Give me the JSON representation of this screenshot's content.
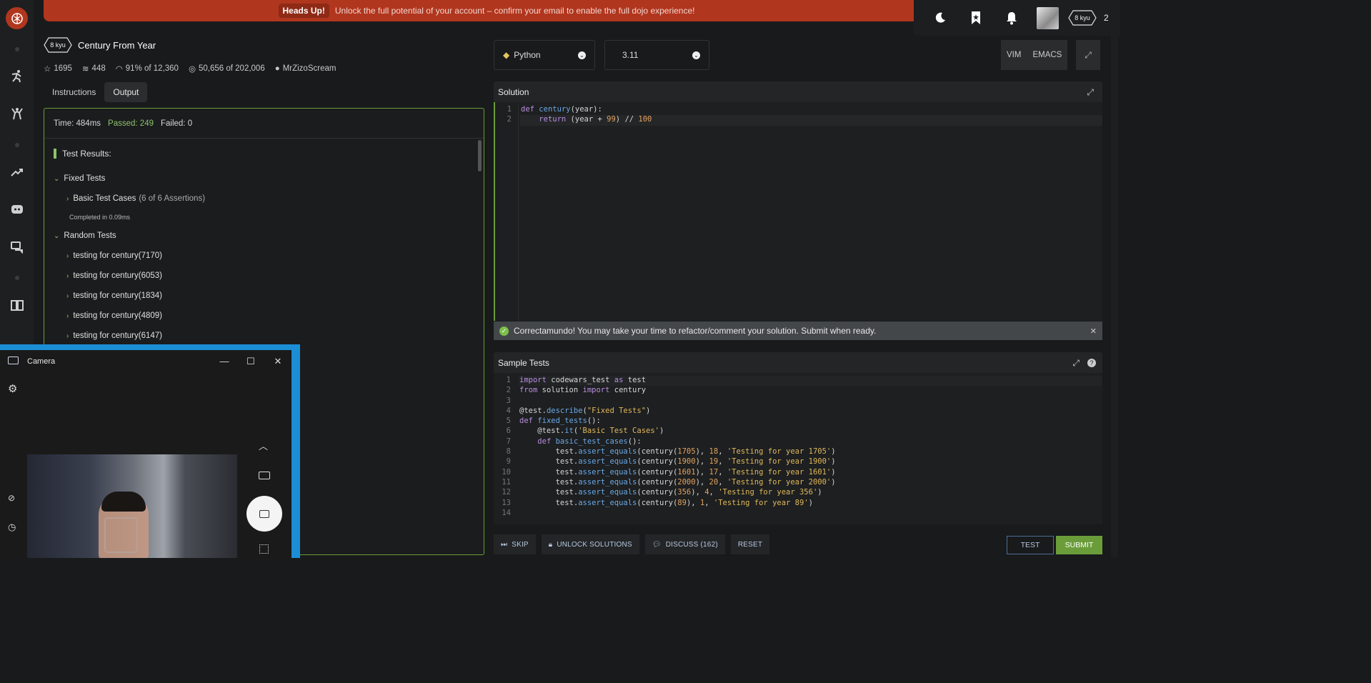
{
  "banner": {
    "badge": "Heads Up!",
    "message": "Unlock the full potential of your account – confirm your email to enable the full dojo experience!"
  },
  "topbar": {
    "rank": "8 kyu",
    "honor": "2"
  },
  "kata": {
    "rank": "8 kyu",
    "title": "Century From Year",
    "stars": "1695",
    "collections": "448",
    "satisfaction": "91% of 12,360",
    "completed": "50,656 of 202,006",
    "author": "MrZizoScream"
  },
  "tabs": {
    "instructions": "Instructions",
    "output": "Output"
  },
  "output": {
    "time": "Time: 484ms",
    "passed": "Passed: 249",
    "failed": "Failed: 0",
    "results_title": "Test Results:",
    "fixed_group": "Fixed Tests",
    "fixed_case": "Basic Test Cases",
    "fixed_case_note": "(6 of 6 Assertions)",
    "completed_note": "Completed in 0.09ms",
    "random_group": "Random Tests",
    "random_cases": [
      "testing for century(7170)",
      "testing for century(6053)",
      "testing for century(1834)",
      "testing for century(4809)",
      "testing for century(6147)"
    ]
  },
  "camera": {
    "title": "Camera"
  },
  "editor": {
    "language": "Python",
    "version": "3.11",
    "modes": [
      "VIM",
      "EMACS"
    ],
    "solution_title": "Solution",
    "solution_line_numbers": [
      "1",
      "2"
    ],
    "sample_title": "Sample Tests",
    "sample_line_numbers": [
      "1",
      "2",
      "3",
      "4",
      "5",
      "6",
      "7",
      "8",
      "9",
      "10",
      "11",
      "12",
      "13",
      "14"
    ]
  },
  "message": "Correctamundo! You may take your time to refactor/comment your solution. Submit when ready.",
  "actions": {
    "skip": "SKIP",
    "unlock": "UNLOCK SOLUTIONS",
    "discuss": "DISCUSS (162)",
    "reset": "RESET",
    "test": "TEST",
    "submit": "SUBMIT"
  },
  "colors": {
    "brand": "#b1361e",
    "success": "#6a9d3a",
    "window_accent": "#1b8ed6"
  }
}
